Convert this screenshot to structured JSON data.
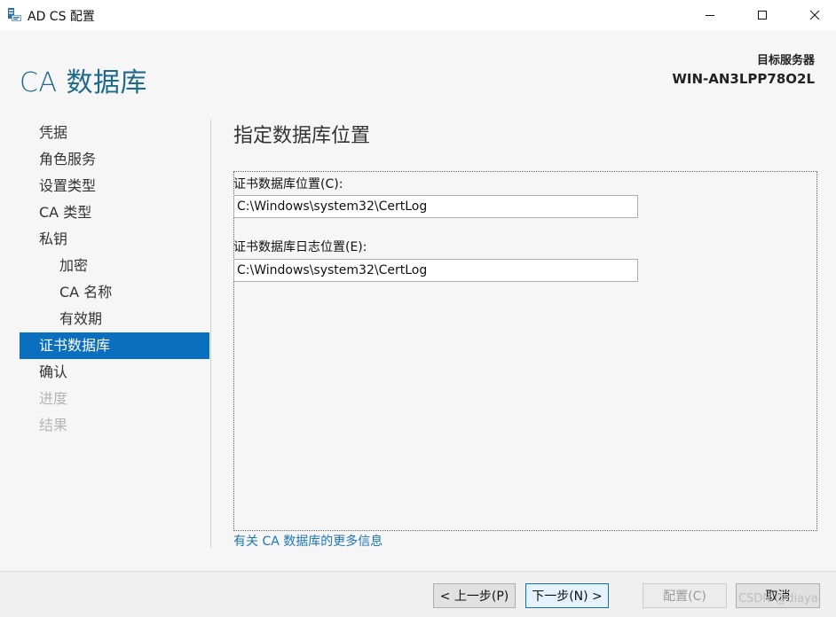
{
  "window": {
    "title": "AD CS 配置"
  },
  "header": {
    "page_title": "CA 数据库",
    "server_label": "目标服务器",
    "server_name": "WIN-AN3LPP78O2L"
  },
  "nav": {
    "items": [
      {
        "label": "凭据",
        "state": "normal"
      },
      {
        "label": "角色服务",
        "state": "normal"
      },
      {
        "label": "设置类型",
        "state": "normal"
      },
      {
        "label": "CA 类型",
        "state": "normal"
      },
      {
        "label": "私钥",
        "state": "normal"
      },
      {
        "label": "加密",
        "state": "normal"
      },
      {
        "label": "CA 名称",
        "state": "normal"
      },
      {
        "label": "有效期",
        "state": "normal"
      },
      {
        "label": "证书数据库",
        "state": "active"
      },
      {
        "label": "确认",
        "state": "normal"
      },
      {
        "label": "进度",
        "state": "disabled"
      },
      {
        "label": "结果",
        "state": "disabled"
      }
    ]
  },
  "content": {
    "section_title": "指定数据库位置",
    "db_location_label": "证书数据库位置(C):",
    "db_location_value": "C:\\Windows\\system32\\CertLog",
    "log_location_label": "证书数据库日志位置(E):",
    "log_location_value": "C:\\Windows\\system32\\CertLog",
    "more_info_link": "有关 CA 数据库的更多信息"
  },
  "footer": {
    "prev_label": "< 上一步(P)",
    "next_label": "下一步(N) >",
    "configure_label": "配置(C)",
    "cancel_label": "取消"
  },
  "watermark": "CSDN @diaya",
  "colors": {
    "accent": "#0a6fbe",
    "title": "#1e6a8a",
    "link": "#1e74b8",
    "disabled": "#b5b5b5"
  }
}
